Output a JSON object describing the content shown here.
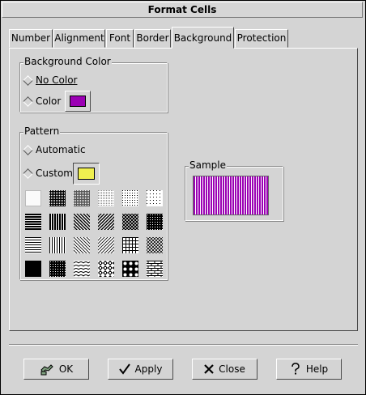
{
  "window": {
    "title": "Format Cells"
  },
  "tabs": [
    {
      "label": "Number"
    },
    {
      "label": "Alignment"
    },
    {
      "label": "Font"
    },
    {
      "label": "Border"
    },
    {
      "label": "Background",
      "active": true
    },
    {
      "label": "Protection"
    }
  ],
  "background_color": {
    "title": "Background Color",
    "options": [
      {
        "label": "No Color",
        "selected": false
      },
      {
        "label": "Color",
        "selected": true
      }
    ],
    "color": "#9b00b4"
  },
  "pattern": {
    "title": "Pattern",
    "options": [
      {
        "label": "Automatic",
        "selected": false
      },
      {
        "label": "Custom",
        "selected": true
      }
    ],
    "custom_color": "#f0f050"
  },
  "sample": {
    "title": "Sample",
    "fill": "#9b00b4",
    "stripe": "#ffffff"
  },
  "buttons": {
    "ok": "OK",
    "apply": "Apply",
    "close": "Close",
    "help": "Help"
  }
}
